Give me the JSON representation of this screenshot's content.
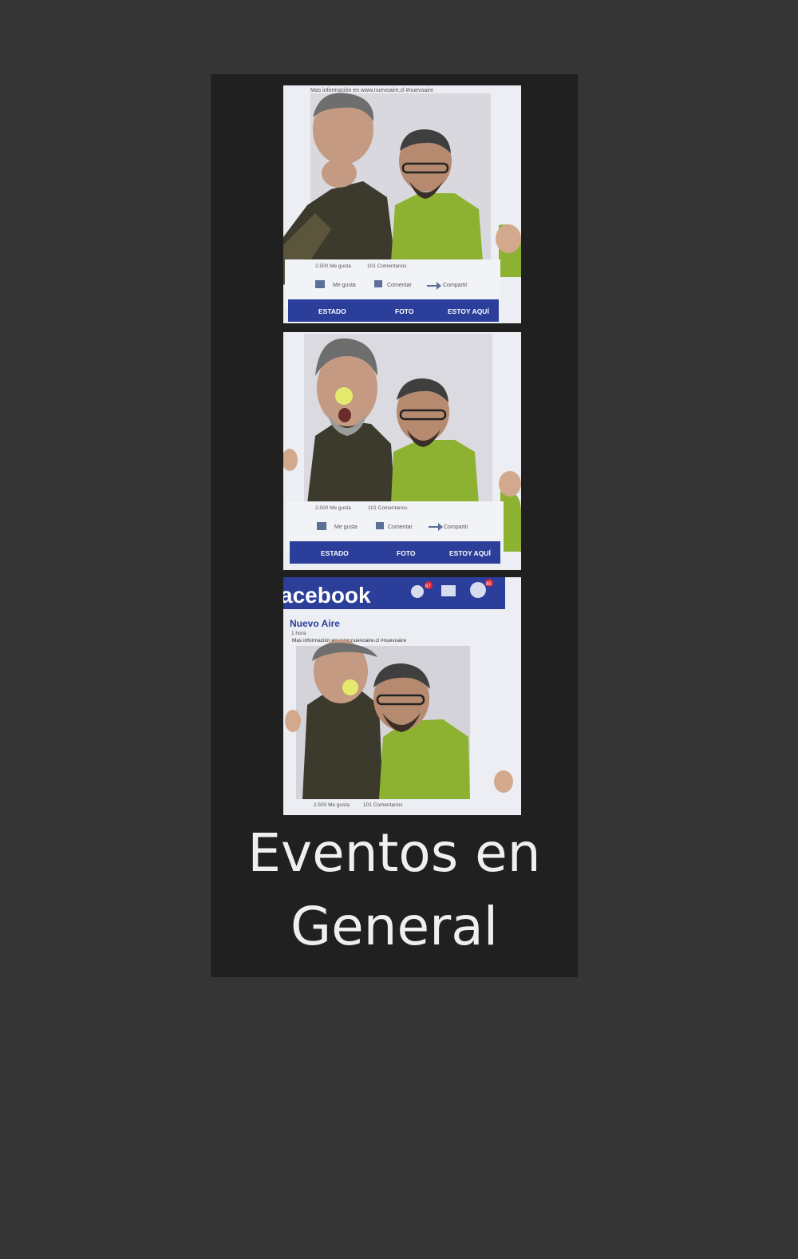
{
  "caption": {
    "line1": "Eventos en",
    "line2": "General"
  },
  "frame_text": {
    "info_line": "Mas información en www.nuevoaire.cl #nuevoaire",
    "likes": "2.500 Me gusta",
    "comments": "101 Comentarios",
    "like_label": "Me gusta",
    "comment_label": "Comentar",
    "share_label": "Compartir",
    "estado": "ESTADO",
    "foto": "FOTO",
    "estoy_aqui": "ESTOY AQUÍ",
    "brand": "acebook",
    "page_name": "Nuevo Aire",
    "time": "1 hora",
    "friend_badge": "67",
    "globe_badge": "85"
  },
  "colors": {
    "page_bg": "#353535",
    "strip_bg": "#202020",
    "fb_blue": "#2a3e9a",
    "caption": "#efefef"
  }
}
